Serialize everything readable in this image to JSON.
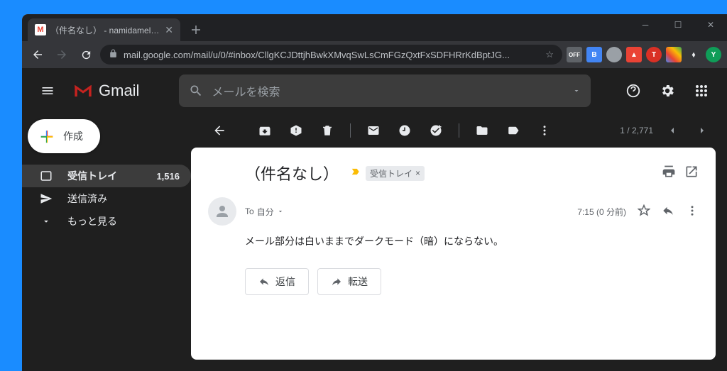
{
  "browser": {
    "tab_title": "（件名なし） - namidamelife@g",
    "url": "mail.google.com/mail/u/0/#inbox/CllgKCJDttjhBwkXMvqSwLsCmFGzQxtFxSDFHRrKdBptJG..."
  },
  "header": {
    "product": "Gmail",
    "search_placeholder": "メールを検索"
  },
  "compose_label": "作成",
  "sidebar": {
    "items": [
      {
        "label": "受信トレイ",
        "count": "1,516"
      },
      {
        "label": "送信済み",
        "count": ""
      },
      {
        "label": "もっと見る",
        "count": ""
      }
    ]
  },
  "pager": {
    "text": "1 / 2,771"
  },
  "message": {
    "subject": "（件名なし）",
    "inbox_label": "受信トレイ",
    "to_prefix": "To",
    "to_name": "自分",
    "time": "7:15 (0 分前)",
    "body": "メール部分は白いままでダークモード（暗）にならない。",
    "reply_label": "返信",
    "forward_label": "転送"
  }
}
